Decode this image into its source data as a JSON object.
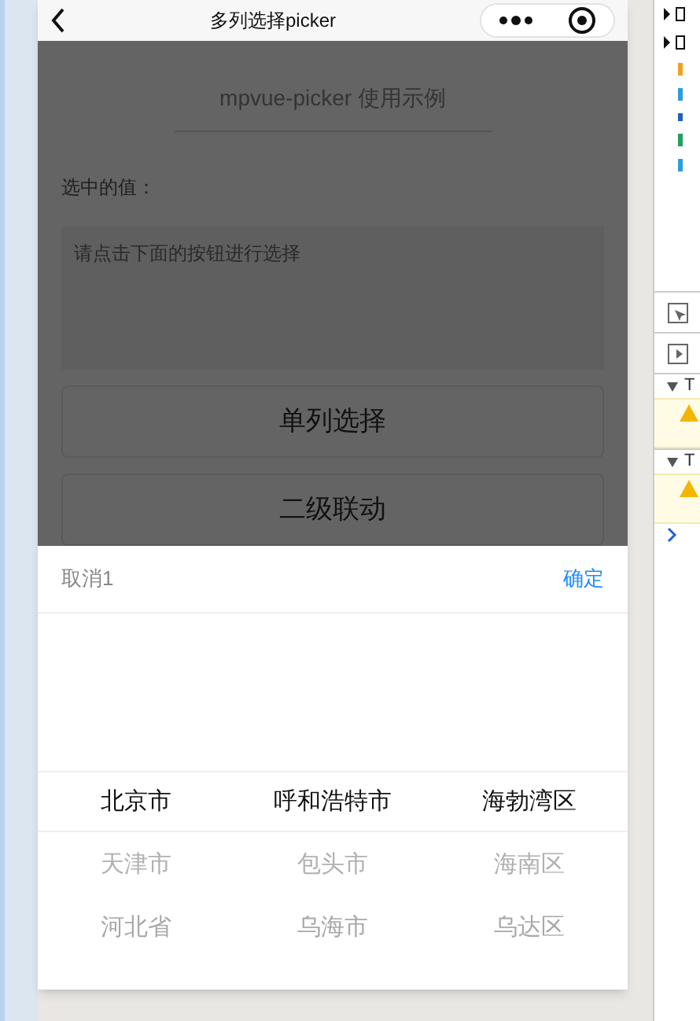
{
  "nav": {
    "title": "多列选择picker"
  },
  "page": {
    "heading": "mpvue-picker 使用示例",
    "value_label": "选中的值：",
    "result": {
      "placeholder": "请点击下面的按钮进行选择"
    },
    "buttons": [
      "单列选择",
      "二级联动"
    ]
  },
  "picker": {
    "cancel": "取消1",
    "confirm": "确定",
    "columns": [
      {
        "items": [
          {
            "label": "北京市",
            "selected": true
          },
          {
            "label": "天津市",
            "selected": false
          },
          {
            "label": "河北省",
            "selected": false
          }
        ]
      },
      {
        "items": [
          {
            "label": "呼和浩特市",
            "selected": true
          },
          {
            "label": "包头市",
            "selected": false
          },
          {
            "label": "乌海市",
            "selected": false
          }
        ]
      },
      {
        "items": [
          {
            "label": "海勃湾区",
            "selected": true
          },
          {
            "label": "海南区",
            "selected": false
          },
          {
            "label": "乌达区",
            "selected": false
          }
        ]
      }
    ]
  },
  "devtools": {
    "groups": [
      {
        "label": "T"
      },
      {
        "label": "T"
      }
    ]
  }
}
